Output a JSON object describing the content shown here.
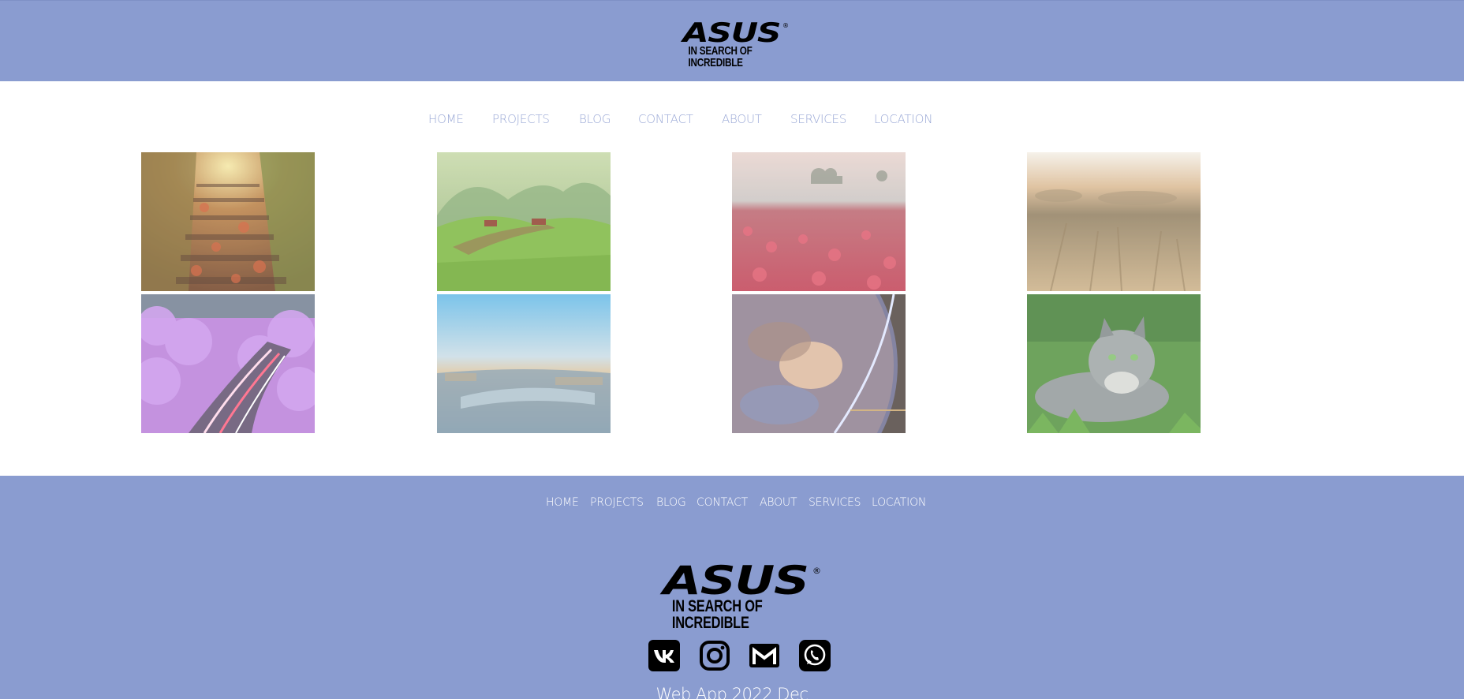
{
  "header": {
    "logo": {
      "brand": "ASUS",
      "tagline": "IN SEARCH OF INCREDIBLE",
      "reg": "®"
    }
  },
  "nav": {
    "items": [
      "HOME",
      "PROJECTS",
      "BLOG",
      "CONTACT",
      "ABOUT",
      "SERVICES",
      "LOCATION"
    ]
  },
  "gallery": {
    "images": [
      {
        "subject": "autumn forest stairs"
      },
      {
        "subject": "green valley with houses and mountains"
      },
      {
        "subject": "field of red tulips at sunrise"
      },
      {
        "subject": "golden wheat field at sunset"
      },
      {
        "subject": "purple blossom trees over light-trail road"
      },
      {
        "subject": "aerial city view at dawn"
      },
      {
        "subject": "planet earth from space"
      },
      {
        "subject": "grey fluffy cat in grass"
      }
    ]
  },
  "footer": {
    "nav_items": [
      "HOME",
      "PROJECTS",
      "BLOG",
      "CONTACT",
      "ABOUT",
      "SERVICES",
      "LOCATION"
    ],
    "logo": {
      "brand": "ASUS",
      "tagline": "IN SEARCH OF INCREDIBLE",
      "reg": "®"
    },
    "social": [
      {
        "name": "vk-icon"
      },
      {
        "name": "instagram-icon"
      },
      {
        "name": "gmail-icon"
      },
      {
        "name": "whatsapp-icon"
      }
    ],
    "copyright": "Web App 2022 Dec"
  },
  "colors": {
    "accent": "#8a9cd0",
    "nav_text": "#9aa8d6",
    "footer_text": "#ffffff"
  }
}
